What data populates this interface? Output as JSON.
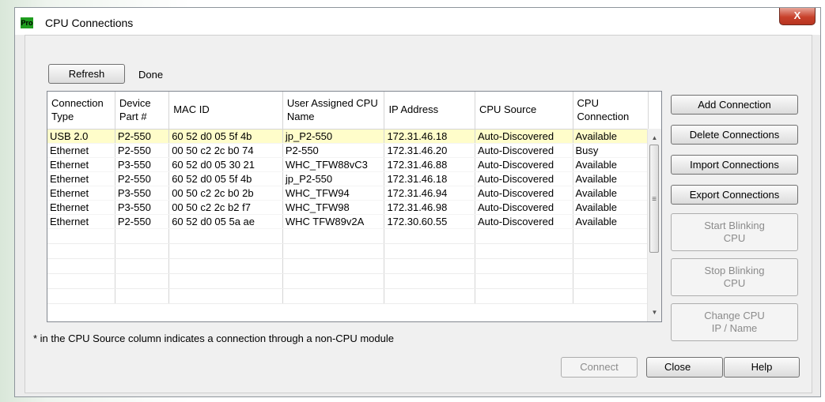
{
  "window": {
    "icon_text": "Pro",
    "title": "CPU Connections",
    "close_label": "X"
  },
  "toolbar": {
    "refresh_label": "Refresh",
    "status": "Done"
  },
  "table": {
    "headers": [
      "Connection Type",
      "Device Part #",
      "MAC ID",
      "User Assigned CPU Name",
      "IP Address",
      "CPU Source",
      "CPU Connection"
    ],
    "rows": [
      [
        "USB 2.0",
        "P2-550",
        "60 52 d0 05 5f 4b",
        "jp_P2-550",
        "172.31.46.18",
        "Auto-Discovered",
        "Available"
      ],
      [
        "Ethernet",
        "P2-550",
        "00 50 c2 2c b0 74",
        "P2-550",
        "172.31.46.20",
        "Auto-Discovered",
        "Busy"
      ],
      [
        "Ethernet",
        "P3-550",
        "60 52 d0 05 30 21",
        "WHC_TFW88vC3",
        "172.31.46.88",
        "Auto-Discovered",
        "Available"
      ],
      [
        "Ethernet",
        "P2-550",
        "60 52 d0 05 5f 4b",
        "jp_P2-550",
        "172.31.46.18",
        "Auto-Discovered",
        "Available"
      ],
      [
        "Ethernet",
        "P3-550",
        "00 50 c2 2c b0 2b",
        "WHC_TFW94",
        "172.31.46.94",
        "Auto-Discovered",
        "Available"
      ],
      [
        "Ethernet",
        "P3-550",
        "00 50 c2 2c b2 f7",
        "WHC_TFW98",
        "172.31.46.98",
        "Auto-Discovered",
        "Available"
      ],
      [
        "Ethernet",
        "P2-550",
        "60 52 d0 05 5a ae",
        "WHC  TFW89v2A",
        "172.30.60.55",
        "Auto-Discovered",
        "Available"
      ]
    ],
    "selected_row": 0
  },
  "side_buttons": {
    "add": "Add Connection",
    "delete": "Delete Connections",
    "import": "Import Connections",
    "export": "Export Connections",
    "start_blinking": "Start Blinking CPU",
    "stop_blinking": "Stop Blinking CPU",
    "change_cpu": "Change CPU IP / Name"
  },
  "footnote": "* in the CPU Source column indicates a connection through a non-CPU module",
  "bottom_buttons": {
    "connect": "Connect",
    "close": "Close",
    "help": "Help"
  },
  "colors": {
    "selected_row": "#fffdca",
    "app_icon": "#1f9d1f",
    "close_button": "#c8412b"
  },
  "icons": {
    "scroll_up": "up-arrow-icon",
    "scroll_down": "down-arrow-icon",
    "grip": "scroll-grip-icon"
  }
}
